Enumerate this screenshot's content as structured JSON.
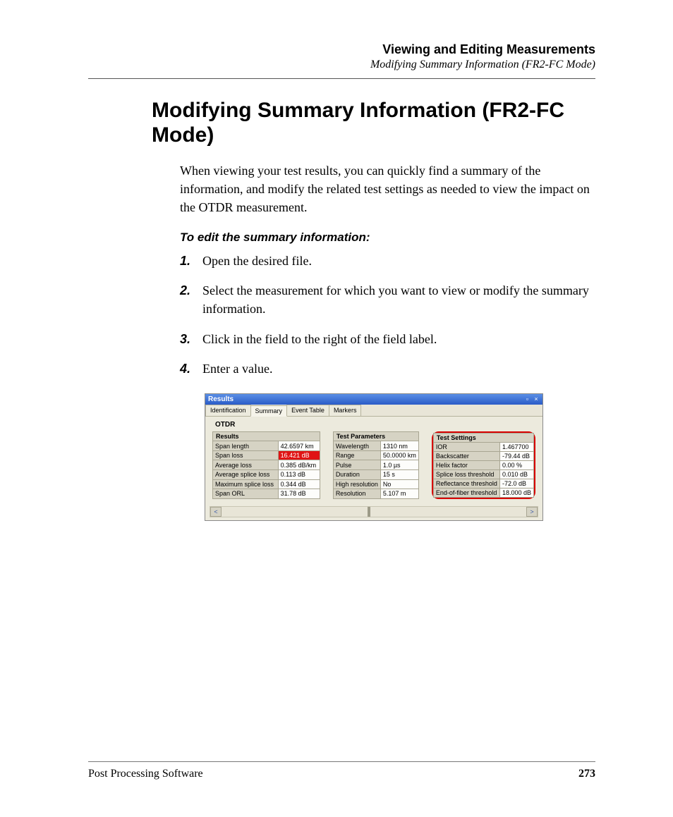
{
  "header": {
    "title": "Viewing and Editing Measurements",
    "subtitle": "Modifying Summary Information (FR2-FC Mode)"
  },
  "h1": "Modifying Summary Information (FR2-FC Mode)",
  "intro": "When viewing your test results, you can quickly find a summary of the information, and modify the related test settings as needed to view the impact on the OTDR measurement.",
  "procedure_heading": "To edit the summary information:",
  "steps": [
    "Open the desired file.",
    "Select the measurement for which you want to view or modify the summary information.",
    "Click in the field to the right of the field label.",
    "Enter a value."
  ],
  "screenshot": {
    "window_title": "Results",
    "tabs": [
      "Identification",
      "Summary",
      "Event Table",
      "Markers"
    ],
    "active_tab_index": 1,
    "section_label": "OTDR",
    "results": {
      "header": "Results",
      "rows": [
        {
          "label": "Span length",
          "value": "42.6597 km"
        },
        {
          "label": "Span loss",
          "value": "16.421 dB",
          "red": true
        },
        {
          "label": "Average loss",
          "value": "0.385 dB/km"
        },
        {
          "label": "Average splice loss",
          "value": "0.113 dB"
        },
        {
          "label": "Maximum splice loss",
          "value": "0.344 dB"
        },
        {
          "label": "Span ORL",
          "value": "31.78 dB"
        }
      ]
    },
    "test_parameters": {
      "header": "Test Parameters",
      "rows": [
        {
          "label": "Wavelength",
          "value": "1310 nm"
        },
        {
          "label": "Range",
          "value": "50.0000 km"
        },
        {
          "label": "Pulse",
          "value": "1.0 µs"
        },
        {
          "label": "Duration",
          "value": "15 s"
        },
        {
          "label": "High resolution",
          "value": "No"
        },
        {
          "label": "Resolution",
          "value": "5.107 m"
        }
      ]
    },
    "test_settings": {
      "header": "Test Settings",
      "rows": [
        {
          "label": "IOR",
          "value": "1.467700"
        },
        {
          "label": "Backscatter",
          "value": "-79.44 dB"
        },
        {
          "label": "Helix factor",
          "value": "0.00 %"
        },
        {
          "label": "Splice loss threshold",
          "value": "0.010 dB"
        },
        {
          "label": "Reflectance threshold",
          "value": "-72.0 dB"
        },
        {
          "label": "End-of-fiber threshold",
          "value": "18.000 dB"
        }
      ]
    }
  },
  "footer": {
    "left": "Post Processing Software",
    "page": "273"
  }
}
